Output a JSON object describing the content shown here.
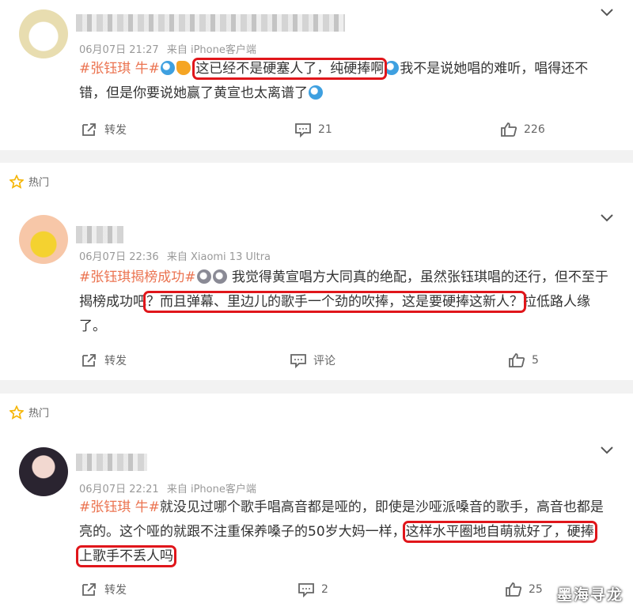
{
  "comments": [
    {
      "hot_label": "",
      "time": "06月07日 21:27",
      "source": "来自 iPhone客户端",
      "tag": "#张钰琪 牛#",
      "text_highlight": "这已经不是硬塞人了，纯硬捧啊",
      "text_after": "我不是说她唱的难听，唱得还不错，但是你要说她赢了黄宣也太离谱了",
      "repost_label": "转发",
      "comment_count": "21",
      "like_count": "226"
    },
    {
      "hot_label": "热门",
      "time": "06月07日 22:36",
      "source": "来自 Xiaomi 13 Ultra",
      "tag": "#张钰琪揭榜成功#",
      "text_before": "我觉得黄宣唱方大同真的绝配，虽然张钰琪唱的还行，但不至于揭榜成功吧",
      "text_highlight": "？而且弹幕、里边儿的歌手一个劲的吹捧，这是要硬捧这新人？",
      "text_after": "拉低路人缘了。",
      "repost_label": "转发",
      "comment_label": "评论",
      "like_count": "5"
    },
    {
      "hot_label": "热门",
      "time": "06月07日 22:21",
      "source": "来自 iPhone客户端",
      "tag": "#张钰琪 牛#",
      "text_before": "就没见过哪个歌手唱高音都是哑的，即使是沙哑派嗓音的歌手，高音也都是亮的。这个哑的就跟不注重保养嗓子的50岁大妈一样，",
      "text_highlight_1": "这样水平圈地自萌就好了，硬捧",
      "text_highlight_2": "上歌手不丢人吗",
      "repost_label": "转发",
      "comment_count": "2",
      "like_count": "25"
    }
  ],
  "watermark": "墨海寻龙",
  "colors": {
    "tag": "#eb7350",
    "highlight_box": "#e0161b",
    "hot_star": "#f5b400"
  }
}
